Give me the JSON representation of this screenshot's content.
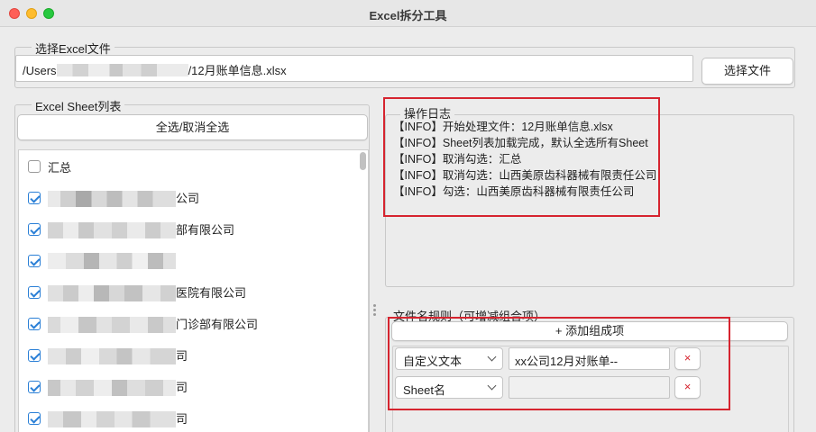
{
  "window": {
    "title": "Excel拆分工具"
  },
  "file_section": {
    "title": "选择Excel文件",
    "path_prefix": "/Users",
    "path_suffix": "/12月账单信息.xlsx",
    "choose_button": "选择文件"
  },
  "sheet_section": {
    "title": "Excel Sheet列表",
    "select_all_button": "全选/取消全选",
    "items": [
      {
        "label": "汇总",
        "checked": false
      },
      {
        "label": "公司",
        "checked": true
      },
      {
        "label": "部有限公司",
        "checked": true
      },
      {
        "label": "",
        "checked": true
      },
      {
        "label": "医院有限公司",
        "checked": true
      },
      {
        "label": "门诊部有限公司",
        "checked": true
      },
      {
        "label": "司",
        "checked": true
      },
      {
        "label": "司",
        "checked": true
      },
      {
        "label": "司",
        "checked": true
      }
    ]
  },
  "log_section": {
    "title": "操作日志",
    "lines": [
      "【INFO】开始处理文件：12月账单信息.xlsx",
      "【INFO】Sheet列表加载完成，默认全选所有Sheet",
      "【INFO】取消勾选：汇总",
      "【INFO】取消勾选：山西美原齿科器械有限责任公司",
      "【INFO】勾选：山西美原齿科器械有限责任公司"
    ]
  },
  "rule_section": {
    "title": "文件名规则（可增减组合项）",
    "add_button": "+ 添加组成项",
    "rows": [
      {
        "type": "自定义文本",
        "value": "xx公司12月对账单--",
        "delete": "×"
      },
      {
        "type": "Sheet名",
        "value": "",
        "delete": "×"
      }
    ]
  },
  "colors": {
    "annotation_red": "#d6242f",
    "checkbox_blue": "#2a7fd6"
  }
}
